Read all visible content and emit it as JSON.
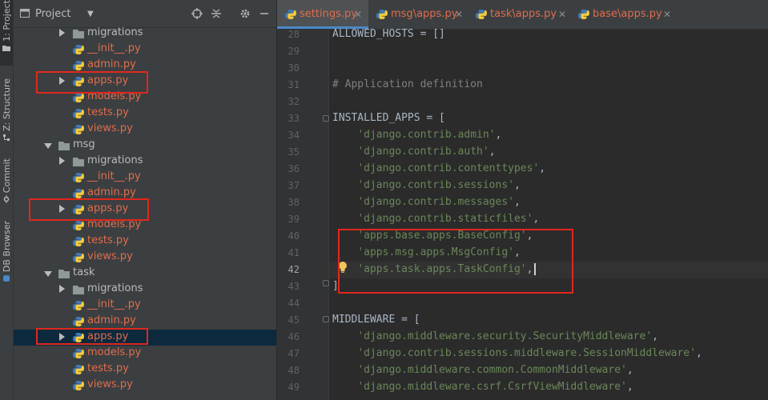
{
  "left_strip": {
    "tabs": [
      {
        "label": "1: Project",
        "icon": "folder-icon"
      },
      {
        "label": "Z: Structure",
        "icon": "structure-icon"
      },
      {
        "label": "Commit",
        "icon": "commit-icon"
      },
      {
        "label": "DB Browser",
        "icon": "database-icon"
      }
    ]
  },
  "project_panel": {
    "title": "Project",
    "tree": [
      {
        "name": "migrations",
        "type": "folder",
        "expanded": false
      },
      {
        "name": "__init__.py",
        "type": "py"
      },
      {
        "name": "admin.py",
        "type": "py"
      },
      {
        "name": "apps.py",
        "type": "py",
        "arrow": true,
        "highlight": true
      },
      {
        "name": "models.py",
        "type": "py"
      },
      {
        "name": "tests.py",
        "type": "py"
      },
      {
        "name": "views.py",
        "type": "py"
      },
      {
        "name": "msg",
        "type": "folder",
        "expanded": true
      },
      {
        "name": "migrations",
        "type": "folder",
        "expanded": false
      },
      {
        "name": "__init__.py",
        "type": "py"
      },
      {
        "name": "admin.py",
        "type": "py"
      },
      {
        "name": "apps.py",
        "type": "py",
        "arrow": true,
        "highlight": true
      },
      {
        "name": "models.py",
        "type": "py"
      },
      {
        "name": "tests.py",
        "type": "py"
      },
      {
        "name": "views.py",
        "type": "py"
      },
      {
        "name": "task",
        "type": "folder",
        "expanded": true
      },
      {
        "name": "migrations",
        "type": "folder",
        "expanded": false
      },
      {
        "name": "__init__.py",
        "type": "py"
      },
      {
        "name": "admin.py",
        "type": "py"
      },
      {
        "name": "apps.py",
        "type": "py",
        "arrow": true,
        "highlight": true,
        "selected": true
      },
      {
        "name": "models.py",
        "type": "py"
      },
      {
        "name": "tests.py",
        "type": "py"
      },
      {
        "name": "views.py",
        "type": "py"
      }
    ]
  },
  "editor_tabs": [
    {
      "label": "settings.py",
      "active": true
    },
    {
      "label": "msg\\apps.py",
      "active": false
    },
    {
      "label": "task\\apps.py",
      "active": false
    },
    {
      "label": "base\\apps.py",
      "active": false
    }
  ],
  "code": {
    "current_line": 42,
    "lines": [
      {
        "n": "28",
        "segs": [
          {
            "t": "ALLOWED_HOSTS = []",
            "k": "p"
          }
        ]
      },
      {
        "n": "29",
        "segs": []
      },
      {
        "n": "30",
        "segs": []
      },
      {
        "n": "31",
        "segs": [
          {
            "t": "# Application definition",
            "k": "c"
          }
        ]
      },
      {
        "n": "32",
        "segs": []
      },
      {
        "n": "33",
        "segs": [
          {
            "t": "INSTALLED_APPS = [",
            "k": "p"
          }
        ]
      },
      {
        "n": "34",
        "segs": [
          {
            "t": "    ",
            "k": "p"
          },
          {
            "t": "'django.contrib.admin'",
            "k": "s"
          },
          {
            "t": ",",
            "k": "p"
          }
        ]
      },
      {
        "n": "35",
        "segs": [
          {
            "t": "    ",
            "k": "p"
          },
          {
            "t": "'django.contrib.auth'",
            "k": "s"
          },
          {
            "t": ",",
            "k": "p"
          }
        ]
      },
      {
        "n": "36",
        "segs": [
          {
            "t": "    ",
            "k": "p"
          },
          {
            "t": "'django.contrib.contenttypes'",
            "k": "s"
          },
          {
            "t": ",",
            "k": "p"
          }
        ]
      },
      {
        "n": "37",
        "segs": [
          {
            "t": "    ",
            "k": "p"
          },
          {
            "t": "'django.contrib.sessions'",
            "k": "s"
          },
          {
            "t": ",",
            "k": "p"
          }
        ]
      },
      {
        "n": "38",
        "segs": [
          {
            "t": "    ",
            "k": "p"
          },
          {
            "t": "'django.contrib.messages'",
            "k": "s"
          },
          {
            "t": ",",
            "k": "p"
          }
        ]
      },
      {
        "n": "39",
        "segs": [
          {
            "t": "    ",
            "k": "p"
          },
          {
            "t": "'django.contrib.staticfiles'",
            "k": "s"
          },
          {
            "t": ",",
            "k": "p"
          }
        ]
      },
      {
        "n": "40",
        "segs": [
          {
            "t": "    ",
            "k": "p"
          },
          {
            "t": "'apps.base.apps.BaseConfig'",
            "k": "s"
          },
          {
            "t": ",",
            "k": "p"
          }
        ]
      },
      {
        "n": "41",
        "segs": [
          {
            "t": "    ",
            "k": "p"
          },
          {
            "t": "'apps.msg.apps.MsgConfig'",
            "k": "s"
          },
          {
            "t": ",",
            "k": "p"
          }
        ]
      },
      {
        "n": "42",
        "segs": [
          {
            "t": "    ",
            "k": "p"
          },
          {
            "t": "'apps.task.apps.TaskConfig'",
            "k": "s"
          },
          {
            "t": ",",
            "k": "p"
          }
        ]
      },
      {
        "n": "43",
        "segs": [
          {
            "t": "]",
            "k": "p"
          }
        ]
      },
      {
        "n": "44",
        "segs": []
      },
      {
        "n": "45",
        "segs": [
          {
            "t": "MIDDLEWARE = [",
            "k": "p"
          }
        ]
      },
      {
        "n": "46",
        "segs": [
          {
            "t": "    ",
            "k": "p"
          },
          {
            "t": "'django.middleware.security.SecurityMiddleware'",
            "k": "s"
          },
          {
            "t": ",",
            "k": "p"
          }
        ]
      },
      {
        "n": "47",
        "segs": [
          {
            "t": "    ",
            "k": "p"
          },
          {
            "t": "'django.contrib.sessions.middleware.SessionMiddleware'",
            "k": "s"
          },
          {
            "t": ",",
            "k": "p"
          }
        ]
      },
      {
        "n": "48",
        "segs": [
          {
            "t": "    ",
            "k": "p"
          },
          {
            "t": "'django.middleware.common.CommonMiddleware'",
            "k": "s"
          },
          {
            "t": ",",
            "k": "p"
          }
        ]
      },
      {
        "n": "49",
        "segs": [
          {
            "t": "    ",
            "k": "p"
          },
          {
            "t": "'django.middleware.csrf.CsrfViewMiddleware'",
            "k": "s"
          },
          {
            "t": ",",
            "k": "p"
          }
        ]
      }
    ]
  },
  "colors": {
    "editor_bg": "#2b2b2b",
    "panel_bg": "#3c3f41",
    "string": "#6a8759",
    "comment": "#808080",
    "plain": "#a9b7c6",
    "modified_file": "#e06c4d",
    "annotation_red": "#e2271c",
    "selection": "#0d293e"
  }
}
